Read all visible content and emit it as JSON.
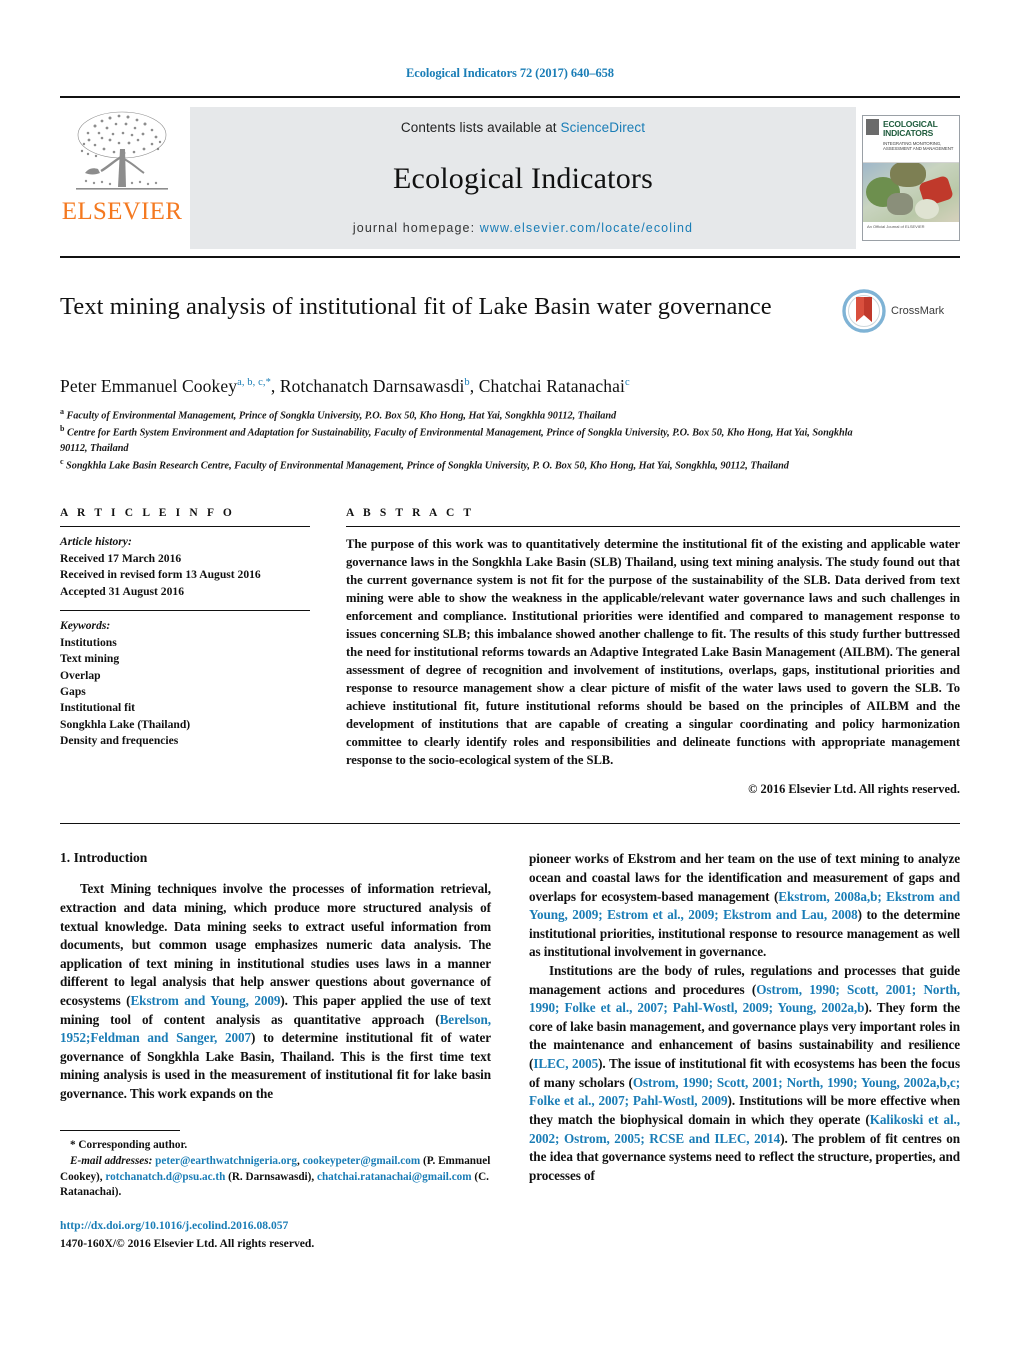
{
  "running_head": "Ecological Indicators 72 (2017) 640–658",
  "masthead": {
    "publisher_name": "ELSEVIER",
    "contents_prefix": "Contents lists available at ",
    "contents_link": "ScienceDirect",
    "journal_title": "Ecological Indicators",
    "homepage_prefix": "journal homepage: ",
    "homepage_url": "www.elsevier.com/locate/ecolind",
    "cover": {
      "title": "ECOLOGICAL INDICATORS",
      "subtitle": "INTEGRATING MONITORING, ASSESSMENT AND MANAGEMENT",
      "footer": "An Official Journal of\nELSEVIER"
    }
  },
  "article": {
    "title": "Text mining analysis of institutional fit of Lake Basin water governance",
    "crossmark_label": "CrossMark",
    "authors_html": "Peter Emmanuel Cookey<sup>a, b, c,</sup><sup class=\"ast\">*</sup>, Rotchanatch Darnsawasdi<sup>b</sup>, Chatchai Ratanachai<sup>c</sup>",
    "affiliations": [
      "Faculty of Environmental Management, Prince of Songkla University, P.O. Box 50, Kho Hong, Hat Yai, Songkhla 90112, Thailand",
      "Centre for Earth System Environment and Adaptation for Sustainability, Faculty of Environmental Management, Prince of Songkla University, P.O. Box 50, Kho Hong, Hat Yai, Songkhla 90112, Thailand",
      "Songkhla Lake Basin Research Centre, Faculty of Environmental Management, Prince of Songkla University, P. O. Box 50, Kho Hong, Hat Yai, Songkhla, 90112, Thailand"
    ],
    "affiliation_markers": [
      "a",
      "b",
      "c"
    ]
  },
  "article_info": {
    "heading": "A R T I C L E  I N F O",
    "history_label": "Article history:",
    "history": [
      "Received 17 March 2016",
      "Received in revised form 13 August 2016",
      "Accepted 31 August 2016"
    ],
    "keywords_label": "Keywords:",
    "keywords": [
      "Institutions",
      "Text mining",
      "Overlap",
      "Gaps",
      "Institutional fit",
      "Songkhla Lake (Thailand)",
      "Density and frequencies"
    ]
  },
  "abstract": {
    "heading": "A B S T R A C T",
    "text": "The purpose of this work was to quantitatively determine the institutional fit of the existing and applicable water governance laws in the Songkhla Lake Basin (SLB) Thailand, using text mining analysis. The study found out that the current governance system is not fit for the purpose of the sustainability of the SLB. Data derived from text mining were able to show the weakness in the applicable/relevant water governance laws and such challenges in enforcement and compliance. Institutional priorities were identified and compared to management response to issues concerning SLB; this imbalance showed another challenge to fit. The results of this study further buttressed the need for institutional reforms towards an Adaptive Integrated Lake Basin Management (AILBM). The general assessment of degree of recognition and involvement of institutions, overlaps, gaps, institutional priorities and response to resource management show a clear picture of misfit of the water laws used to govern the SLB. To achieve institutional fit, future institutional reforms should be based on the principles of AILBM and the development of institutions that are capable of creating a singular coordinating and policy harmonization committee to clearly identify roles and responsibilities and delineate functions with appropriate management response to the socio-ecological system of the SLB.",
    "copyright": "© 2016 Elsevier Ltd. All rights reserved."
  },
  "body": {
    "section_number_title": "1. Introduction",
    "left_paragraphs": [
      "Text Mining techniques involve the processes of information retrieval, extraction and data mining, which produce more structured analysis of textual knowledge. Data mining seeks to extract useful information from documents, but common usage emphasizes numeric data analysis. The application of text mining in institutional studies uses laws in a manner different to legal analysis that help answer questions about governance of ecosystems (Ekstrom and Young, 2009). This paper applied the use of text mining tool of content analysis as quantitative approach (Berelson, 1952;Feldman and Sanger, 2007) to determine institutional fit of water governance of Songkhla Lake Basin, Thailand. This is the first time text mining analysis is used in the measurement of institutional fit for lake basin governance. This work expands on the"
    ],
    "right_paragraphs": [
      "pioneer works of Ekstrom and her team on the use of text mining to analyze ocean and coastal laws for the identification and measurement of gaps and overlaps for ecosystem-based management (Ekstrom, 2008a,b; Ekstrom and Young, 2009; Estrom et al., 2009; Ekstrom and Lau, 2008) to the determine institutional priorities, institutional response to resource management as well as institutional involvement in governance.",
      "Institutions are the body of rules, regulations and processes that guide management actions and procedures (Ostrom, 1990; Scott, 2001; North, 1990; Folke et al., 2007; Pahl-Wostl, 2009; Young, 2002a,b). They form the core of lake basin management, and governance plays very important roles in the maintenance and enhancement of basins sustainability and resilience (ILEC, 2005). The issue of institutional fit with ecosystems has been the focus of many scholars (Ostrom, 1990; Scott, 2001; North, 1990; Young, 2002a,b,c; Folke et al., 2007; Pahl-Wostl, 2009). Institutions will be more effective when they match the biophysical domain in which they operate (Kalikoski et al., 2002; Ostrom, 2005; RCSE and ILEC, 2014). The problem of fit centres on the idea that governance systems need to reflect the structure, properties, and processes of"
    ],
    "left_refs": [
      "Ekstrom and Young, 2009",
      "Berelson, 1952;Feldman and Sanger, 2007"
    ],
    "right_refs": [
      "Ekstrom, 2008a,b; Ekstrom and Young, 2009; Estrom et al., 2009; Ekstrom and Lau, 2008",
      "Ostrom, 1990; Scott, 2001; North, 1990; Folke et al., 2007; Pahl-Wostl, 2009; Young, 2002a,b",
      "ILEC, 2005",
      "Ostrom, 1990; Scott, 2001; North, 1990; Young, 2002a,b,c; Folke et al., 2007; Pahl-Wostl, 2009",
      "Kalikoski et al., 2002; Ostrom, 2005; RCSE and ILEC, 2014"
    ]
  },
  "footnote": {
    "corresponding_author": "* Corresponding author.",
    "email_label": "E-mail addresses:",
    "emails": [
      "peter@earthwatchnigeria.org",
      "cookeypeter@gmail.com",
      "rotchanatch.d@psu.ac.th",
      "chatchai.ratanachai@gmail.com"
    ],
    "email_names": [
      "(P. Emmanuel Cookey)",
      "(R. Darnsawasdi)",
      "(C. Ratanachai)"
    ],
    "doi": "http://dx.doi.org/10.1016/j.ecolind.2016.08.057",
    "issn_line": "1470-160X/© 2016 Elsevier Ltd. All rights reserved."
  },
  "colors": {
    "link_blue": "#1a7db6",
    "elsevier_orange": "#F47920",
    "band_grey": "#e6e8ea",
    "rule_black": "#111111"
  }
}
